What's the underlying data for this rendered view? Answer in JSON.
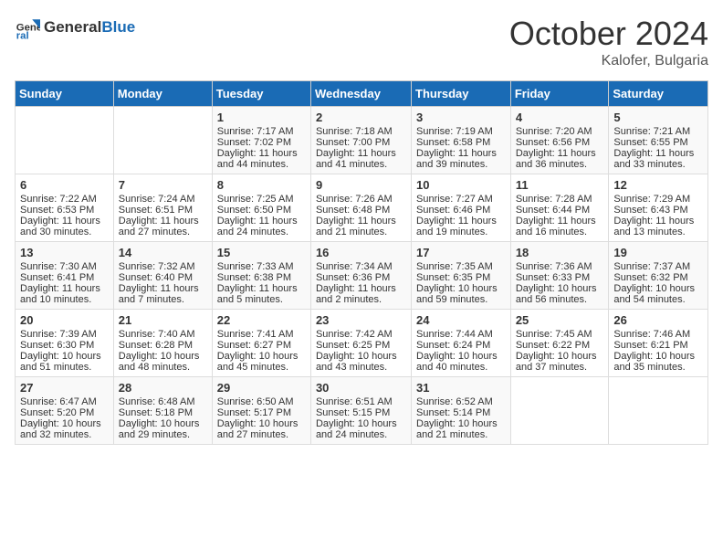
{
  "header": {
    "logo_general": "General",
    "logo_blue": "Blue",
    "title": "October 2024",
    "location": "Kalofer, Bulgaria"
  },
  "weekdays": [
    "Sunday",
    "Monday",
    "Tuesday",
    "Wednesday",
    "Thursday",
    "Friday",
    "Saturday"
  ],
  "weeks": [
    [
      {
        "day": "",
        "sunrise": "",
        "sunset": "",
        "daylight": ""
      },
      {
        "day": "",
        "sunrise": "",
        "sunset": "",
        "daylight": ""
      },
      {
        "day": "1",
        "sunrise": "Sunrise: 7:17 AM",
        "sunset": "Sunset: 7:02 PM",
        "daylight": "Daylight: 11 hours and 44 minutes."
      },
      {
        "day": "2",
        "sunrise": "Sunrise: 7:18 AM",
        "sunset": "Sunset: 7:00 PM",
        "daylight": "Daylight: 11 hours and 41 minutes."
      },
      {
        "day": "3",
        "sunrise": "Sunrise: 7:19 AM",
        "sunset": "Sunset: 6:58 PM",
        "daylight": "Daylight: 11 hours and 39 minutes."
      },
      {
        "day": "4",
        "sunrise": "Sunrise: 7:20 AM",
        "sunset": "Sunset: 6:56 PM",
        "daylight": "Daylight: 11 hours and 36 minutes."
      },
      {
        "day": "5",
        "sunrise": "Sunrise: 7:21 AM",
        "sunset": "Sunset: 6:55 PM",
        "daylight": "Daylight: 11 hours and 33 minutes."
      }
    ],
    [
      {
        "day": "6",
        "sunrise": "Sunrise: 7:22 AM",
        "sunset": "Sunset: 6:53 PM",
        "daylight": "Daylight: 11 hours and 30 minutes."
      },
      {
        "day": "7",
        "sunrise": "Sunrise: 7:24 AM",
        "sunset": "Sunset: 6:51 PM",
        "daylight": "Daylight: 11 hours and 27 minutes."
      },
      {
        "day": "8",
        "sunrise": "Sunrise: 7:25 AM",
        "sunset": "Sunset: 6:50 PM",
        "daylight": "Daylight: 11 hours and 24 minutes."
      },
      {
        "day": "9",
        "sunrise": "Sunrise: 7:26 AM",
        "sunset": "Sunset: 6:48 PM",
        "daylight": "Daylight: 11 hours and 21 minutes."
      },
      {
        "day": "10",
        "sunrise": "Sunrise: 7:27 AM",
        "sunset": "Sunset: 6:46 PM",
        "daylight": "Daylight: 11 hours and 19 minutes."
      },
      {
        "day": "11",
        "sunrise": "Sunrise: 7:28 AM",
        "sunset": "Sunset: 6:44 PM",
        "daylight": "Daylight: 11 hours and 16 minutes."
      },
      {
        "day": "12",
        "sunrise": "Sunrise: 7:29 AM",
        "sunset": "Sunset: 6:43 PM",
        "daylight": "Daylight: 11 hours and 13 minutes."
      }
    ],
    [
      {
        "day": "13",
        "sunrise": "Sunrise: 7:30 AM",
        "sunset": "Sunset: 6:41 PM",
        "daylight": "Daylight: 11 hours and 10 minutes."
      },
      {
        "day": "14",
        "sunrise": "Sunrise: 7:32 AM",
        "sunset": "Sunset: 6:40 PM",
        "daylight": "Daylight: 11 hours and 7 minutes."
      },
      {
        "day": "15",
        "sunrise": "Sunrise: 7:33 AM",
        "sunset": "Sunset: 6:38 PM",
        "daylight": "Daylight: 11 hours and 5 minutes."
      },
      {
        "day": "16",
        "sunrise": "Sunrise: 7:34 AM",
        "sunset": "Sunset: 6:36 PM",
        "daylight": "Daylight: 11 hours and 2 minutes."
      },
      {
        "day": "17",
        "sunrise": "Sunrise: 7:35 AM",
        "sunset": "Sunset: 6:35 PM",
        "daylight": "Daylight: 10 hours and 59 minutes."
      },
      {
        "day": "18",
        "sunrise": "Sunrise: 7:36 AM",
        "sunset": "Sunset: 6:33 PM",
        "daylight": "Daylight: 10 hours and 56 minutes."
      },
      {
        "day": "19",
        "sunrise": "Sunrise: 7:37 AM",
        "sunset": "Sunset: 6:32 PM",
        "daylight": "Daylight: 10 hours and 54 minutes."
      }
    ],
    [
      {
        "day": "20",
        "sunrise": "Sunrise: 7:39 AM",
        "sunset": "Sunset: 6:30 PM",
        "daylight": "Daylight: 10 hours and 51 minutes."
      },
      {
        "day": "21",
        "sunrise": "Sunrise: 7:40 AM",
        "sunset": "Sunset: 6:28 PM",
        "daylight": "Daylight: 10 hours and 48 minutes."
      },
      {
        "day": "22",
        "sunrise": "Sunrise: 7:41 AM",
        "sunset": "Sunset: 6:27 PM",
        "daylight": "Daylight: 10 hours and 45 minutes."
      },
      {
        "day": "23",
        "sunrise": "Sunrise: 7:42 AM",
        "sunset": "Sunset: 6:25 PM",
        "daylight": "Daylight: 10 hours and 43 minutes."
      },
      {
        "day": "24",
        "sunrise": "Sunrise: 7:44 AM",
        "sunset": "Sunset: 6:24 PM",
        "daylight": "Daylight: 10 hours and 40 minutes."
      },
      {
        "day": "25",
        "sunrise": "Sunrise: 7:45 AM",
        "sunset": "Sunset: 6:22 PM",
        "daylight": "Daylight: 10 hours and 37 minutes."
      },
      {
        "day": "26",
        "sunrise": "Sunrise: 7:46 AM",
        "sunset": "Sunset: 6:21 PM",
        "daylight": "Daylight: 10 hours and 35 minutes."
      }
    ],
    [
      {
        "day": "27",
        "sunrise": "Sunrise: 6:47 AM",
        "sunset": "Sunset: 5:20 PM",
        "daylight": "Daylight: 10 hours and 32 minutes."
      },
      {
        "day": "28",
        "sunrise": "Sunrise: 6:48 AM",
        "sunset": "Sunset: 5:18 PM",
        "daylight": "Daylight: 10 hours and 29 minutes."
      },
      {
        "day": "29",
        "sunrise": "Sunrise: 6:50 AM",
        "sunset": "Sunset: 5:17 PM",
        "daylight": "Daylight: 10 hours and 27 minutes."
      },
      {
        "day": "30",
        "sunrise": "Sunrise: 6:51 AM",
        "sunset": "Sunset: 5:15 PM",
        "daylight": "Daylight: 10 hours and 24 minutes."
      },
      {
        "day": "31",
        "sunrise": "Sunrise: 6:52 AM",
        "sunset": "Sunset: 5:14 PM",
        "daylight": "Daylight: 10 hours and 21 minutes."
      },
      {
        "day": "",
        "sunrise": "",
        "sunset": "",
        "daylight": ""
      },
      {
        "day": "",
        "sunrise": "",
        "sunset": "",
        "daylight": ""
      }
    ]
  ]
}
